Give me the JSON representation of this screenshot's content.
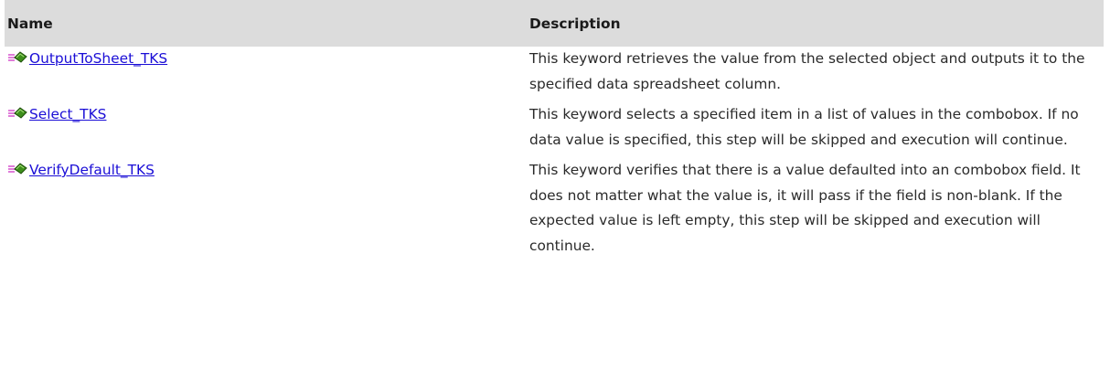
{
  "table": {
    "headers": {
      "name": "Name",
      "description": "Description"
    },
    "rows": [
      {
        "icon": "method-icon",
        "name": "OutputToSheet_TKS",
        "description": "This keyword retrieves the value from the selected object and outputs it to the specified data spreadsheet column."
      },
      {
        "icon": "method-icon",
        "name": "Select_TKS",
        "description": "This keyword selects a specified item in a list of values in the combobox. If no data value is specified, this step will be skipped and execution will continue."
      },
      {
        "icon": "method-icon",
        "name": "VerifyDefault_TKS",
        "description": "This keyword verifies that there is a value defaulted into an combobox field. It does not matter what the value is, it will pass if the field is non-blank. If the expected value is left empty, this step will be skipped and execution will continue."
      }
    ]
  },
  "colors": {
    "header_bg": "#dcdcdc",
    "link": "#1a0dd6",
    "icon_green": "#3e8f1c",
    "icon_pink": "#d95bd0"
  }
}
